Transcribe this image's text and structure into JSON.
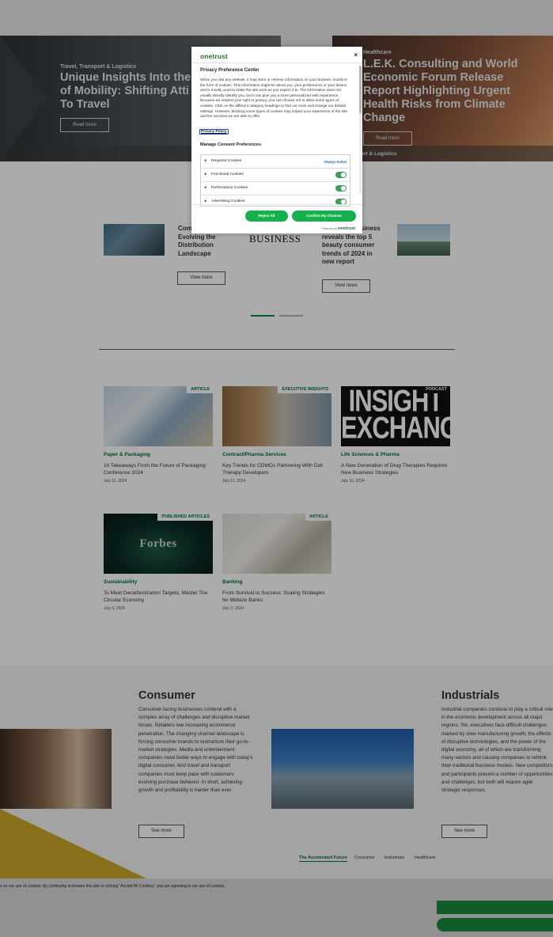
{
  "hero": {
    "left": {
      "category": "Travel, Transport & Logistics",
      "title_lines": [
        "Unique Insights Into the",
        "of Mobility: Shifting Atti",
        "To Travel"
      ],
      "button": "Read more"
    },
    "right": {
      "category": "Healthcare",
      "title_lines": [
        "L.E.K. Consulting and World",
        "Economic Forum Release",
        "Report Highlighting Urgent",
        "Health Risks from Climate",
        "Change"
      ],
      "button": "Read more",
      "category_tail": "ort & Logistics"
    }
  },
  "news": {
    "left_lines": [
      "Com",
      "Evolving the",
      "Distribution",
      "Landscape"
    ],
    "left_button": "View more",
    "logo_text": "BUSINESS",
    "right_lines": [
      "usiness",
      "reveals the top 5",
      "beauty consumer",
      "trends of 2024 in",
      "new report"
    ],
    "right_button": "View news"
  },
  "insights": [
    {
      "badge": "ARTICLE",
      "category": "Paper & Packaging",
      "title": "10 Takeaways From the Future of Packaging Conference 2024",
      "date": "July 11, 2024"
    },
    {
      "badge": "EXECUTIVE INSIGHTS",
      "category": "Contract/Pharma Services",
      "title": "Key Trends for CDMOs Partnering With Cell Therapy Developers",
      "date": "July 11, 2024"
    },
    {
      "badge": "PODCAST",
      "category": "Life Sciences & Pharma",
      "title": "A New Generation of Drug Therapies Requires New Business Strategies",
      "date": "July 10, 2024",
      "thumb_text": [
        "INSIGHT",
        "EXCHANGE"
      ]
    },
    {
      "badge": "PUBLISHED ARTICLES",
      "category": "Sustainability",
      "title": "To Meet Decarbonization Targets, Master The Circular Economy",
      "date": "July 9, 2024",
      "thumb_text": "Forbes"
    },
    {
      "badge": "ARTICLE",
      "category": "Banking",
      "title": "From Survival to Success: Scaling Strategies for Midsize Banks",
      "date": "July 3, 2024"
    }
  ],
  "industries": {
    "consumer": {
      "title": "Consumer",
      "text": "Consumer-facing businesses contend with a complex array of challenges and disruptive market forces. Retailers see increasing ecommerce penetration. The changing channel landscape is forcing consumer brands to restructure their go-to-market strategies. Media and entertainment companies need better ways to engage with today's digital consumer. And travel and transport companies must keep pace with customers' evolving purchase behavior. In short, achieving growth and profitability is harder than ever.",
      "button": "See more"
    },
    "industrials": {
      "title": "Industrials",
      "text": "Industrial companies continue to play a critical role in the economic development across all major regions. Yet, executives face difficult challenges marked by slow manufacturing growth, the effects of disruptive technologies, and the power of the digital economy, all of which are transforming many sectors and causing companies to rethink their traditional business models. New competitors and participants present a number of opportunities and challenges, but both will require agile strategic responses.",
      "button": "See more"
    },
    "tabs": [
      "The Accelerated Future",
      "Consumer",
      "Industrials",
      "Healthcare"
    ]
  },
  "cookie_bar": {
    "text": "s on our use of cookies. By continuing to browse this site or clicking \"Accept All Cookies,\" you are agreeing to our use of cookies."
  },
  "modal": {
    "brand": "onetrust",
    "close": "×",
    "title": "Privacy Preference Center",
    "description": "When you visit any website, it may store or retrieve information on your browser, mostly in the form of cookies. This information might be about you, your preferences or your device and is mostly used to make the site work as you expect it to. The information does not usually directly identify you, but it can give you a more personalized web experience. Because we respect your right to privacy, you can choose not to allow some types of cookies. Click on the different category headings to find out more and change our default settings. However, blocking some types of cookies may impact your experience of the site and the services we are able to offer.",
    "privacy_link": "Privacy Policy",
    "manage_title": "Manage Consent Preferences",
    "categories": [
      {
        "label": "Required Cookies",
        "status": "Always Active"
      },
      {
        "label": "Functional Cookies",
        "enabled": true
      },
      {
        "label": "Performance Cookies",
        "enabled": true
      },
      {
        "label": "Advertising Cookies",
        "enabled": true
      }
    ],
    "reject_button": "Reject All",
    "confirm_button": "Confirm My Choices",
    "powered_by": "Powered by",
    "powered_brand": "onetrust"
  }
}
